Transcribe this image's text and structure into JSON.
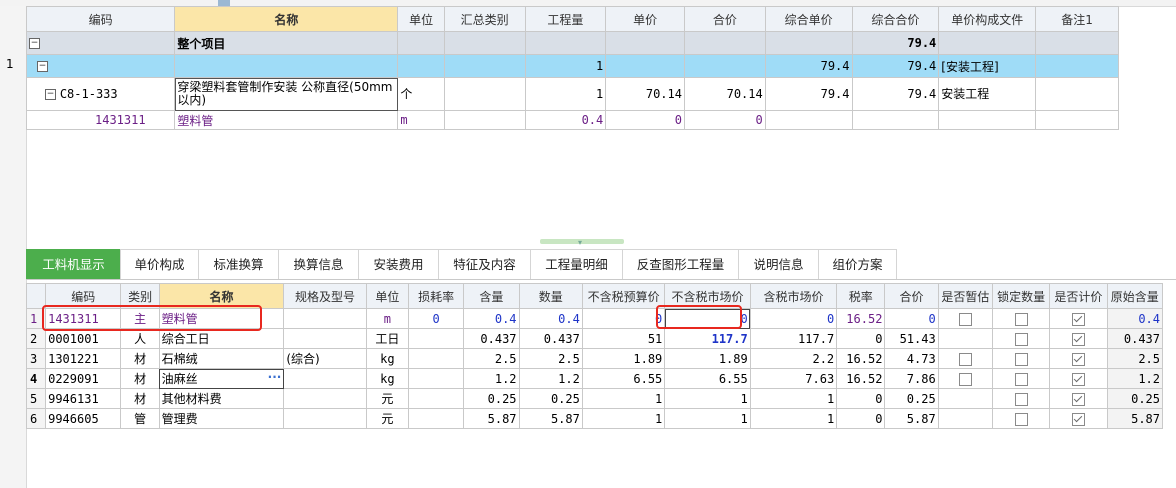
{
  "upper": {
    "headers": [
      "编码",
      "名称",
      "单位",
      "汇总类别",
      "工程量",
      "单价",
      "合价",
      "综合单价",
      "综合合价",
      "单价构成文件",
      "备注1"
    ],
    "total_row": {
      "code_mark": "−",
      "name": "整个项目",
      "total": "79.4"
    },
    "section_row": {
      "rowno": "1",
      "code_mark": "−",
      "qty": "1",
      "unit_price_comp": "79.4",
      "total_comp": "79.4",
      "file": "[安装工程]"
    },
    "item_row": {
      "code_mark": "−",
      "code": "C8-1-333",
      "name": "穿梁塑料套管制作安装 公称直径(50mm以内)",
      "unit": "个",
      "qty": "1",
      "price": "70.14",
      "amount": "70.14",
      "unit_price_comp": "79.4",
      "total_comp": "79.4",
      "file": "安装工程"
    },
    "material_row": {
      "code": "1431311",
      "name": "塑料管",
      "unit": "m",
      "qty": "0.4",
      "price": "0",
      "amount": "0"
    }
  },
  "tabs": [
    "工料机显示",
    "单价构成",
    "标准换算",
    "换算信息",
    "安装费用",
    "特征及内容",
    "工程量明细",
    "反查图形工程量",
    "说明信息",
    "组价方案"
  ],
  "lower": {
    "headers": [
      "编码",
      "类别",
      "名称",
      "规格及型号",
      "单位",
      "损耗率",
      "含量",
      "数量",
      "不含税预算价",
      "不含税市场价",
      "含税市场价",
      "税率",
      "合价",
      "是否暂估",
      "锁定数量",
      "是否计价",
      "原始含量"
    ],
    "rows": [
      {
        "no": "1",
        "code": "1431311",
        "type": "主",
        "name": "塑料管",
        "spec": "",
        "unit": "m",
        "loss": "0",
        "content": "0.4",
        "qty": "0.4",
        "budget": "0",
        "market": "0",
        "market_tax": "0",
        "tax": "16.52",
        "amount": "0",
        "est": true,
        "lock": true,
        "priced": true,
        "orig": "0.4"
      },
      {
        "no": "2",
        "code": "0001001",
        "type": "人",
        "name": "综合工日",
        "spec": "",
        "unit": "工日",
        "loss": "",
        "content": "0.437",
        "qty": "0.437",
        "budget": "51",
        "market": "117.7",
        "market_tax": "117.7",
        "tax": "0",
        "amount": "51.43",
        "est": false,
        "lock": true,
        "priced": true,
        "orig": "0.437"
      },
      {
        "no": "3",
        "code": "1301221",
        "type": "材",
        "name": "石棉绒",
        "spec": "(综合)",
        "unit": "kg",
        "loss": "",
        "content": "2.5",
        "qty": "2.5",
        "budget": "1.89",
        "market": "1.89",
        "market_tax": "2.2",
        "tax": "16.52",
        "amount": "4.73",
        "est": true,
        "lock": true,
        "priced": true,
        "orig": "2.5"
      },
      {
        "no": "4",
        "code": "0229091",
        "type": "材",
        "name": "油麻丝",
        "spec": "",
        "unit": "kg",
        "loss": "",
        "content": "1.2",
        "qty": "1.2",
        "budget": "6.55",
        "market": "6.55",
        "market_tax": "7.63",
        "tax": "16.52",
        "amount": "7.86",
        "est": true,
        "lock": true,
        "priced": true,
        "orig": "1.2"
      },
      {
        "no": "5",
        "code": "9946131",
        "type": "材",
        "name": "其他材料费",
        "spec": "",
        "unit": "元",
        "loss": "",
        "content": "0.25",
        "qty": "0.25",
        "budget": "1",
        "market": "1",
        "market_tax": "1",
        "tax": "0",
        "amount": "0.25",
        "est": false,
        "lock": true,
        "priced": true,
        "orig": "0.25"
      },
      {
        "no": "6",
        "code": "9946605",
        "type": "管",
        "name": "管理费",
        "spec": "",
        "unit": "元",
        "loss": "",
        "content": "5.87",
        "qty": "5.87",
        "budget": "1",
        "market": "1",
        "market_tax": "1",
        "tax": "0",
        "amount": "5.87",
        "est": false,
        "lock": true,
        "priced": true,
        "orig": "5.87"
      }
    ],
    "ellipsis": "···"
  },
  "colors": {
    "accent": "#4cae4c",
    "selected_row": "#9fdcf7",
    "name_header": "#fbe6a8",
    "highlight": "#e8281f",
    "material_text": "#6b1f86",
    "blue_value": "#1e34c8"
  }
}
